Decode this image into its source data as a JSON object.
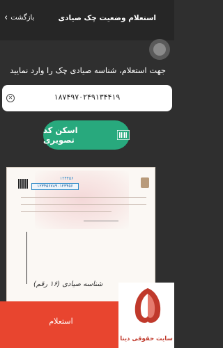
{
  "header": {
    "back_label": "بازگشت",
    "title": "استعلام وضعیت چک صیادی"
  },
  "prompt": "جهت استعلام، شناسه صیادی چک را وارد نمایید",
  "input": {
    "value": "۱۸۷۴۹۷۰۲۴۹۱۳۴۴۱۹"
  },
  "scan_button": {
    "label": "اسکن کد تصویری"
  },
  "cheque_image": {
    "highlighted_code": "۱۲۳۴۵۶۷۸۹۰۱۲۳۴۵۶",
    "top_number": "۱۲۴۴۵۶",
    "caption": "شناسه صیادی (۱۶ رقم)"
  },
  "bottom_bar": {
    "submit_label": "استعلام",
    "color": "#e8452f"
  },
  "brand": {
    "name": "سایت حقوقی دینا"
  }
}
